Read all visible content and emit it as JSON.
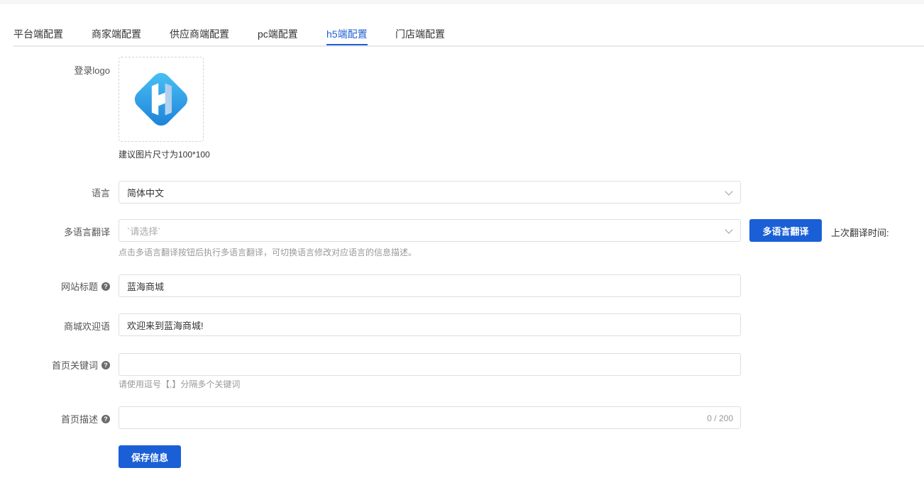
{
  "tabs": [
    {
      "label": "平台端配置"
    },
    {
      "label": "商家端配置"
    },
    {
      "label": "供应商端配置"
    },
    {
      "label": "pc端配置"
    },
    {
      "label": "h5端配置",
      "active": true
    },
    {
      "label": "门店端配置"
    }
  ],
  "logo": {
    "label": "登录logo",
    "hint": "建议图片尺寸为100*100",
    "icon": "h-brand-logo"
  },
  "language": {
    "label": "语言",
    "value": "简体中文"
  },
  "translate": {
    "label": "多语言翻译",
    "placeholder": "`请选择`",
    "button": "多语言翻译",
    "last_time_label": "上次翻译时间:",
    "hint": "点击多语言翻译按钮后执行多语言翻译，可切换语言修改对应语言的信息描述。"
  },
  "site_title": {
    "label": "网站标题",
    "value": "蓝海商城"
  },
  "welcome": {
    "label": "商城欢迎语",
    "value": "欢迎来到蓝海商城!"
  },
  "keywords": {
    "label": "首页关键词",
    "value": "",
    "hint": "请使用逗号【,】分隔多个关键词"
  },
  "description": {
    "label": "首页描述",
    "value": "",
    "counter": "0 / 200"
  },
  "save_button": "保存信息",
  "colors": {
    "accent": "#1a5fd6",
    "logo_light": "#38b6f0",
    "logo_dark": "#1565c0"
  }
}
